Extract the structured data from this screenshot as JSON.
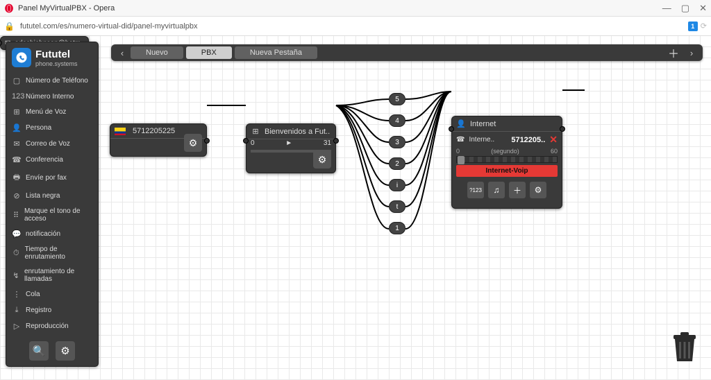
{
  "window": {
    "title": "Panel MyVirtualPBX - Opera"
  },
  "address": {
    "url": "fututel.com/es/numero-virtual-did/panel-myvirtualpbx",
    "ext_badge": "1"
  },
  "brand": {
    "name": "Fututel",
    "sub": "phone.systems"
  },
  "sidebar": {
    "items": [
      {
        "icon": "▢",
        "label": "Número de Teléfono"
      },
      {
        "icon": "123",
        "label": "Número Interno"
      },
      {
        "icon": "⊞",
        "label": "Menú de Voz"
      },
      {
        "icon": "👤",
        "label": "Persona"
      },
      {
        "icon": "✉",
        "label": "Correo de Voz"
      },
      {
        "icon": "☎",
        "label": "Conferencia"
      },
      {
        "icon": "🖶",
        "label": "Envíe por fax"
      },
      {
        "icon": "⊘",
        "label": "Lista negra"
      },
      {
        "icon": "⠿",
        "label": "Marque el tono de acceso"
      },
      {
        "icon": "💬",
        "label": "notificación"
      },
      {
        "icon": "⏱",
        "label": "Tiempo de enrutamiento"
      },
      {
        "icon": "↯",
        "label": "enrutamiento de llamadas"
      },
      {
        "icon": "⋮",
        "label": "Cola"
      },
      {
        "icon": "⤓",
        "label": "Registro"
      },
      {
        "icon": "▷",
        "label": "Reproducción"
      }
    ]
  },
  "tabs": {
    "items": [
      {
        "label": "Nuevo"
      },
      {
        "label": "PBX"
      },
      {
        "label": "Nueva Pestaña"
      }
    ],
    "selected": 1
  },
  "nodes": {
    "did": {
      "number": "5712205225"
    },
    "ivr": {
      "title": "Bienvenidos a Fut..",
      "from": "0",
      "to": "31",
      "play": "►"
    },
    "bub": [
      "5",
      "4",
      "3",
      "2",
      "i",
      "t",
      "1"
    ],
    "inet": {
      "title": "Internet",
      "row_label": "Interne..",
      "row_num": "5712205..",
      "sl_left": "0",
      "sl_lbl": "(segundo)",
      "sl_right": "60",
      "red": "Internet-Voip",
      "btns": [
        "?123",
        "♫",
        "＋",
        "⚙"
      ]
    },
    "mail": {
      "addr": "adeshjohnson@hotm.."
    }
  }
}
